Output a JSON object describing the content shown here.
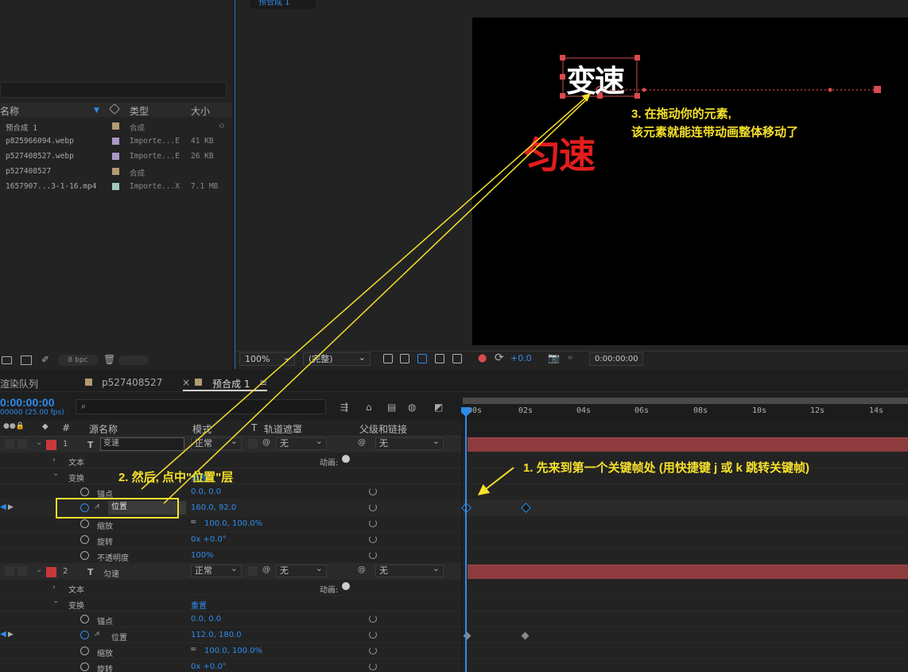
{
  "project": {
    "headers": {
      "name": "名称",
      "type": "类型",
      "size": "大小"
    },
    "items": [
      {
        "name": "预合成 1",
        "type": "合成",
        "size": "",
        "color": "#b39b72"
      },
      {
        "name": "p825966094.webp",
        "type": "Importe...E",
        "size": "41 KB",
        "color": "#a89ac8"
      },
      {
        "name": "p527408527.webp",
        "type": "Importe...E",
        "size": "26 KB",
        "color": "#a89ac8"
      },
      {
        "name": "p527408527",
        "type": "合成",
        "size": "",
        "color": "#b39b72"
      },
      {
        "name": "1657907...3-1-16.mp4",
        "type": "Importe...X",
        "size": "7.1 MB",
        "color": "#a0c8c0"
      }
    ],
    "bpc": "8 bpc"
  },
  "viewer": {
    "tab": "预合成 1",
    "zoom": "100%",
    "quality": "(完整)",
    "exposure": "+0.0",
    "timecode": "0:00:00:00"
  },
  "canvas": {
    "text_top": "变速",
    "text_red": "匀速",
    "annotation_3_line1": "3. 在拖动你的元素,",
    "annotation_3_line2": "该元素就能连带动画整体移动了"
  },
  "timeline": {
    "tabs": {
      "render_queue": "渲染队列",
      "comp_a": "p527408527",
      "comp_b": "预合成 1"
    },
    "time": "0:00:00:00",
    "fps": "00000 (25.00 fps)",
    "columns": {
      "number": "#",
      "source": "源名称",
      "mode": "模式",
      "t": "T",
      "track_matte": "轨道遮罩",
      "parent": "父级和链接"
    },
    "ruler_ticks": [
      "00s",
      "02s",
      "04s",
      "06s",
      "08s",
      "10s",
      "12s",
      "14s"
    ],
    "layers": [
      {
        "index": "1",
        "name": "变速",
        "mode": "正常",
        "matte": "无",
        "parent": "无",
        "text_group": "文本",
        "animate": "动画:",
        "transform_group": "变换",
        "reset": "重置",
        "props": [
          {
            "label": "锚点",
            "value": "0.0, 0.0"
          },
          {
            "label": "位置",
            "value": "160.0, 92.0"
          },
          {
            "label": "缩放",
            "value": "100.0, 100.0%"
          },
          {
            "label": "旋转",
            "value": "0x +0.0°"
          },
          {
            "label": "不透明度",
            "value": "100%"
          }
        ]
      },
      {
        "index": "2",
        "name": "匀速",
        "mode": "正常",
        "matte": "无",
        "parent": "无",
        "text_group": "文本",
        "animate": "动画:",
        "transform_group": "变换",
        "reset": "重置",
        "props": [
          {
            "label": "锚点",
            "value": "0.0, 0.0"
          },
          {
            "label": "位置",
            "value": "112.0, 180.0"
          },
          {
            "label": "缩放",
            "value": "100.0, 100.0%"
          },
          {
            "label": "旋转",
            "value": "0x +0.0°"
          }
        ]
      }
    ]
  },
  "annotations": {
    "step1": "1. 先来到第一个关键帧处 (用快捷键 j 或 k 跳转关键帧)",
    "step2": "2. 然后, 点中\"位置\"层"
  },
  "colors": {
    "accent": "#2d8ceb",
    "annotation": "#f5e02a",
    "label_red": "#c8373b",
    "layer_bar": "#8d3b3f"
  }
}
